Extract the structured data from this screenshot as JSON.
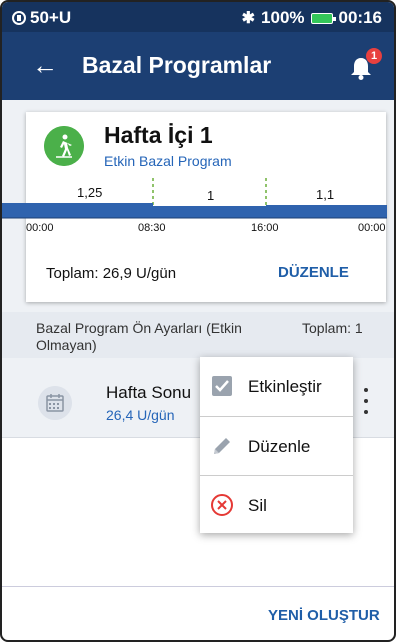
{
  "status_bar": {
    "left_text": "50+U",
    "bluetooth_icon": "bluetooth-icon",
    "battery_percent": "100%",
    "time": "00:16"
  },
  "header": {
    "title": "Bazal Programlar",
    "back_icon": "arrow-left-icon",
    "notification_icon": "bell-icon",
    "notification_count": "1"
  },
  "active_program": {
    "name": "Hafta İçi 1",
    "status": "Etkin Bazal Program",
    "icon": "walking-person-icon",
    "rates": [
      "1,25",
      "1",
      "1,1"
    ],
    "times": [
      "00:00",
      "08:30",
      "16:00",
      "00:00"
    ],
    "total": "Toplam: 26,9 U/gün",
    "edit_label": "DÜZENLE"
  },
  "presets_section": {
    "title": "Bazal Program Ön Ayarları (Etkin Olmayan)",
    "total": "Toplam: 1"
  },
  "preset_items": [
    {
      "name": "Hafta Sonu",
      "value": "26,4 U/gün",
      "icon": "calendar-icon"
    }
  ],
  "context_menu": {
    "items": [
      {
        "label": "Etkinleştir",
        "icon": "checkbox-checked-icon"
      },
      {
        "label": "Düzenle",
        "icon": "pencil-icon"
      },
      {
        "label": "Sil",
        "icon": "delete-circle-x-icon"
      }
    ]
  },
  "footer": {
    "create_label": "YENİ OLUŞTUR"
  },
  "colors": {
    "status_bar": "#16335e",
    "app_bar": "#1c3f73",
    "accent_link": "#1f5ea8",
    "program_icon": "#4bb04a",
    "badge": "#e8403f",
    "delete": "#e53935"
  }
}
